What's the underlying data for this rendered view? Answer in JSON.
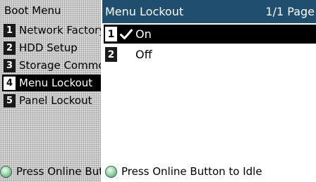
{
  "boot_menu": {
    "title": "Boot Menu",
    "items": [
      {
        "num": "1",
        "label": "Network Factory Defaults"
      },
      {
        "num": "2",
        "label": "HDD Setup"
      },
      {
        "num": "3",
        "label": "Storage Common Setup"
      },
      {
        "num": "4",
        "label": "Menu Lockout"
      },
      {
        "num": "5",
        "label": "Panel Lockout"
      }
    ],
    "selected_index": 3,
    "footer": "Press Online Button to Idle"
  },
  "lockout_panel": {
    "title": "Menu Lockout",
    "page": "1/1 Page",
    "options": [
      {
        "num": "1",
        "label": "On",
        "checked": true
      },
      {
        "num": "2",
        "label": "Off",
        "checked": false
      }
    ],
    "status_message": "Press Online Button to Idle"
  },
  "colors": {
    "header_bg": "#1f4e6f",
    "selection_bg": "#000000",
    "led": "green"
  },
  "icons": {
    "check": "check-icon",
    "online_led": "online-led-icon"
  }
}
